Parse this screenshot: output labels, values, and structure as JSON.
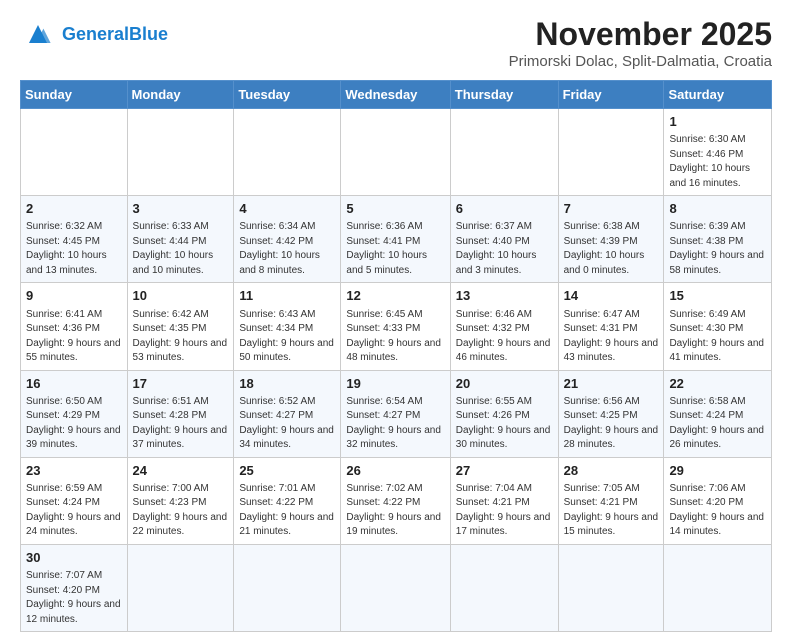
{
  "header": {
    "logo_general": "General",
    "logo_blue": "Blue",
    "month": "November 2025",
    "location": "Primorski Dolac, Split-Dalmatia, Croatia"
  },
  "weekdays": [
    "Sunday",
    "Monday",
    "Tuesday",
    "Wednesday",
    "Thursday",
    "Friday",
    "Saturday"
  ],
  "weeks": [
    [
      {
        "day": "",
        "info": ""
      },
      {
        "day": "",
        "info": ""
      },
      {
        "day": "",
        "info": ""
      },
      {
        "day": "",
        "info": ""
      },
      {
        "day": "",
        "info": ""
      },
      {
        "day": "",
        "info": ""
      },
      {
        "day": "1",
        "info": "Sunrise: 6:30 AM\nSunset: 4:46 PM\nDaylight: 10 hours and 16 minutes."
      }
    ],
    [
      {
        "day": "2",
        "info": "Sunrise: 6:32 AM\nSunset: 4:45 PM\nDaylight: 10 hours and 13 minutes."
      },
      {
        "day": "3",
        "info": "Sunrise: 6:33 AM\nSunset: 4:44 PM\nDaylight: 10 hours and 10 minutes."
      },
      {
        "day": "4",
        "info": "Sunrise: 6:34 AM\nSunset: 4:42 PM\nDaylight: 10 hours and 8 minutes."
      },
      {
        "day": "5",
        "info": "Sunrise: 6:36 AM\nSunset: 4:41 PM\nDaylight: 10 hours and 5 minutes."
      },
      {
        "day": "6",
        "info": "Sunrise: 6:37 AM\nSunset: 4:40 PM\nDaylight: 10 hours and 3 minutes."
      },
      {
        "day": "7",
        "info": "Sunrise: 6:38 AM\nSunset: 4:39 PM\nDaylight: 10 hours and 0 minutes."
      },
      {
        "day": "8",
        "info": "Sunrise: 6:39 AM\nSunset: 4:38 PM\nDaylight: 9 hours and 58 minutes."
      }
    ],
    [
      {
        "day": "9",
        "info": "Sunrise: 6:41 AM\nSunset: 4:36 PM\nDaylight: 9 hours and 55 minutes."
      },
      {
        "day": "10",
        "info": "Sunrise: 6:42 AM\nSunset: 4:35 PM\nDaylight: 9 hours and 53 minutes."
      },
      {
        "day": "11",
        "info": "Sunrise: 6:43 AM\nSunset: 4:34 PM\nDaylight: 9 hours and 50 minutes."
      },
      {
        "day": "12",
        "info": "Sunrise: 6:45 AM\nSunset: 4:33 PM\nDaylight: 9 hours and 48 minutes."
      },
      {
        "day": "13",
        "info": "Sunrise: 6:46 AM\nSunset: 4:32 PM\nDaylight: 9 hours and 46 minutes."
      },
      {
        "day": "14",
        "info": "Sunrise: 6:47 AM\nSunset: 4:31 PM\nDaylight: 9 hours and 43 minutes."
      },
      {
        "day": "15",
        "info": "Sunrise: 6:49 AM\nSunset: 4:30 PM\nDaylight: 9 hours and 41 minutes."
      }
    ],
    [
      {
        "day": "16",
        "info": "Sunrise: 6:50 AM\nSunset: 4:29 PM\nDaylight: 9 hours and 39 minutes."
      },
      {
        "day": "17",
        "info": "Sunrise: 6:51 AM\nSunset: 4:28 PM\nDaylight: 9 hours and 37 minutes."
      },
      {
        "day": "18",
        "info": "Sunrise: 6:52 AM\nSunset: 4:27 PM\nDaylight: 9 hours and 34 minutes."
      },
      {
        "day": "19",
        "info": "Sunrise: 6:54 AM\nSunset: 4:27 PM\nDaylight: 9 hours and 32 minutes."
      },
      {
        "day": "20",
        "info": "Sunrise: 6:55 AM\nSunset: 4:26 PM\nDaylight: 9 hours and 30 minutes."
      },
      {
        "day": "21",
        "info": "Sunrise: 6:56 AM\nSunset: 4:25 PM\nDaylight: 9 hours and 28 minutes."
      },
      {
        "day": "22",
        "info": "Sunrise: 6:58 AM\nSunset: 4:24 PM\nDaylight: 9 hours and 26 minutes."
      }
    ],
    [
      {
        "day": "23",
        "info": "Sunrise: 6:59 AM\nSunset: 4:24 PM\nDaylight: 9 hours and 24 minutes."
      },
      {
        "day": "24",
        "info": "Sunrise: 7:00 AM\nSunset: 4:23 PM\nDaylight: 9 hours and 22 minutes."
      },
      {
        "day": "25",
        "info": "Sunrise: 7:01 AM\nSunset: 4:22 PM\nDaylight: 9 hours and 21 minutes."
      },
      {
        "day": "26",
        "info": "Sunrise: 7:02 AM\nSunset: 4:22 PM\nDaylight: 9 hours and 19 minutes."
      },
      {
        "day": "27",
        "info": "Sunrise: 7:04 AM\nSunset: 4:21 PM\nDaylight: 9 hours and 17 minutes."
      },
      {
        "day": "28",
        "info": "Sunrise: 7:05 AM\nSunset: 4:21 PM\nDaylight: 9 hours and 15 minutes."
      },
      {
        "day": "29",
        "info": "Sunrise: 7:06 AM\nSunset: 4:20 PM\nDaylight: 9 hours and 14 minutes."
      }
    ],
    [
      {
        "day": "30",
        "info": "Sunrise: 7:07 AM\nSunset: 4:20 PM\nDaylight: 9 hours and 12 minutes."
      },
      {
        "day": "",
        "info": ""
      },
      {
        "day": "",
        "info": ""
      },
      {
        "day": "",
        "info": ""
      },
      {
        "day": "",
        "info": ""
      },
      {
        "day": "",
        "info": ""
      },
      {
        "day": "",
        "info": ""
      }
    ]
  ]
}
